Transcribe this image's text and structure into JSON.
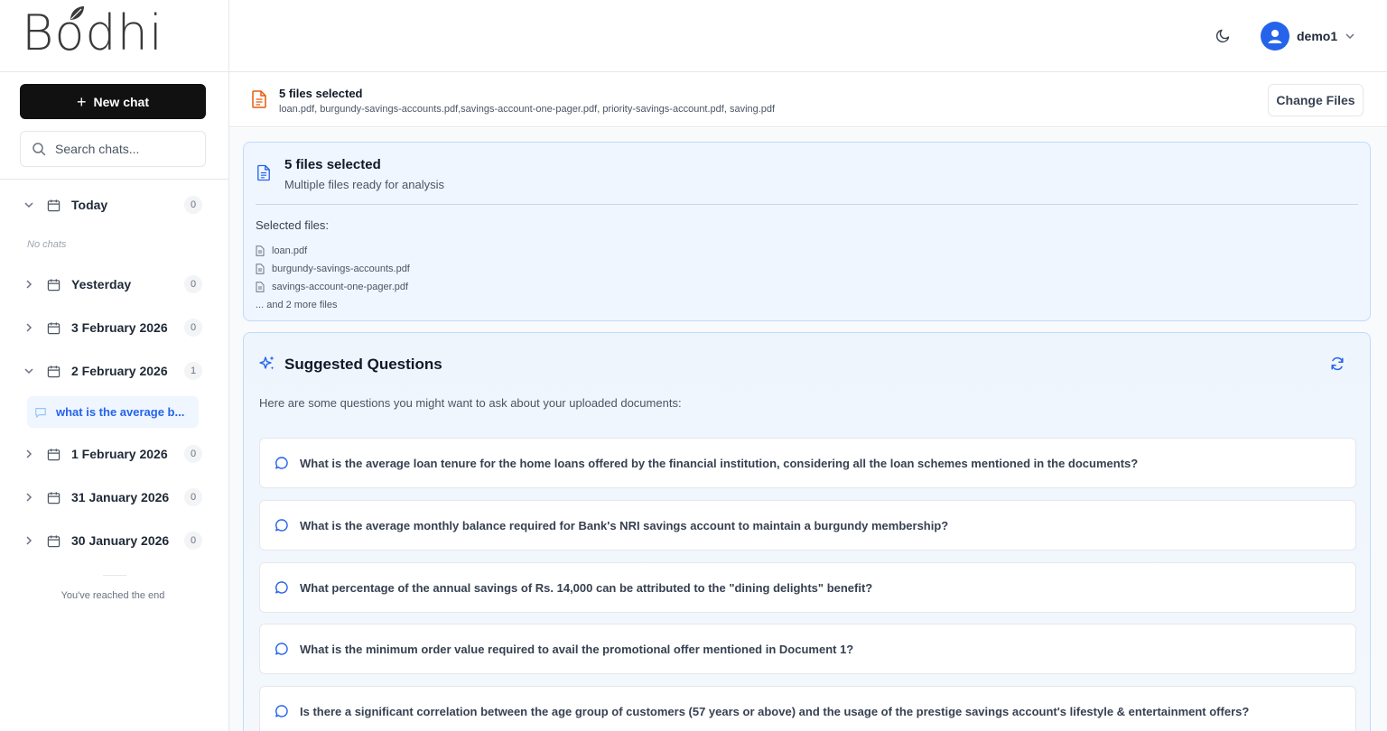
{
  "app": {
    "logo_text": "Bodhi"
  },
  "sidebar": {
    "new_chat_label": "New chat",
    "search_placeholder": "Search chats...",
    "groups": [
      {
        "label": "Today",
        "count": "0",
        "expanded": true
      },
      {
        "label": "Yesterday",
        "count": "0",
        "expanded": false
      },
      {
        "label": "3 February 2026",
        "count": "0",
        "expanded": false
      },
      {
        "label": "2 February 2026",
        "count": "1",
        "expanded": true
      },
      {
        "label": "1 February 2026",
        "count": "0",
        "expanded": false
      },
      {
        "label": "31 January 2026",
        "count": "0",
        "expanded": false
      },
      {
        "label": "30 January 2026",
        "count": "0",
        "expanded": false
      }
    ],
    "no_chats_text": "No chats",
    "chat_items": [
      {
        "label": "what is the average b..."
      }
    ],
    "end_text": "You've reached the end"
  },
  "header": {
    "username": "demo1"
  },
  "file_bar": {
    "title": "5 files selected",
    "file_names": "loan.pdf, burgundy-savings-accounts.pdf,savings-account-one-pager.pdf, priority-savings-account.pdf, saving.pdf",
    "change_files_label": "Change Files"
  },
  "files_card": {
    "title": "5 files selected",
    "subtitle": "Multiple files ready for analysis",
    "selected_label": "Selected files:",
    "files": [
      "loan.pdf",
      "burgundy-savings-accounts.pdf",
      "savings-account-one-pager.pdf"
    ],
    "more_text": "... and 2 more files"
  },
  "suggested": {
    "title": "Suggested Questions",
    "description": "Here are some questions you might want to ask about your uploaded documents:",
    "questions": [
      "What is the average loan tenure for the home loans offered by the financial institution, considering all the loan schemes mentioned in the documents?",
      "What is the average monthly balance required for Bank's NRI savings account to maintain a burgundy membership?",
      "What percentage of the annual savings of Rs. 14,000 can be attributed to the \"dining delights\" benefit?",
      "What is the minimum order value required to avail the promotional offer mentioned in Document 1?",
      "Is there a significant correlation between the age group of customers (57 years or above) and the usage of the prestige savings account's lifestyle & entertainment offers?"
    ]
  },
  "colors": {
    "accent": "#2563eb",
    "file_icon": "#ea580c",
    "card_border": "#bfdbfe",
    "card_bg": "#eff6ff"
  }
}
